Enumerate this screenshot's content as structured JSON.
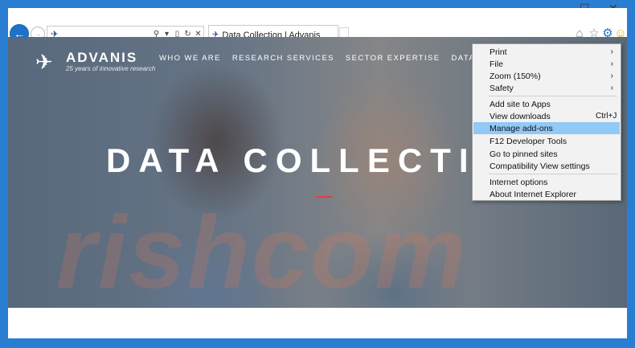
{
  "browser": {
    "tab_title": "Data Collection | Advanis",
    "address_value": "",
    "controls": {
      "minimize": "─",
      "maximize": "☐",
      "close": "✕"
    }
  },
  "site": {
    "logo_name": "ADVANIS",
    "logo_tagline": "25 years of innovative research",
    "nav": [
      "WHO WE ARE",
      "RESEARCH SERVICES",
      "SECTOR EXPERTISE",
      "DATA COLLECTI"
    ],
    "hero_title": "DATA COLLECTIO",
    "watermark": "rishcom",
    "accent_color": "#e83a3a"
  },
  "menu": {
    "items": [
      {
        "label": "Print",
        "aux": "›"
      },
      {
        "label": "File",
        "aux": "›"
      },
      {
        "label": "Zoom (150%)",
        "aux": "›"
      },
      {
        "label": "Safety",
        "aux": "›"
      },
      {
        "label": "Add site to Apps",
        "aux": ""
      },
      {
        "label": "View downloads",
        "aux": "Ctrl+J"
      },
      {
        "label": "Manage add-ons",
        "aux": "",
        "highlighted": true
      },
      {
        "label": "F12 Developer Tools",
        "aux": ""
      },
      {
        "label": "Go to pinned sites",
        "aux": ""
      },
      {
        "label": "Compatibility View settings",
        "aux": ""
      },
      {
        "label": "Internet options",
        "aux": ""
      },
      {
        "label": "About Internet Explorer",
        "aux": ""
      }
    ],
    "highlight_color": "#91c9f7"
  }
}
